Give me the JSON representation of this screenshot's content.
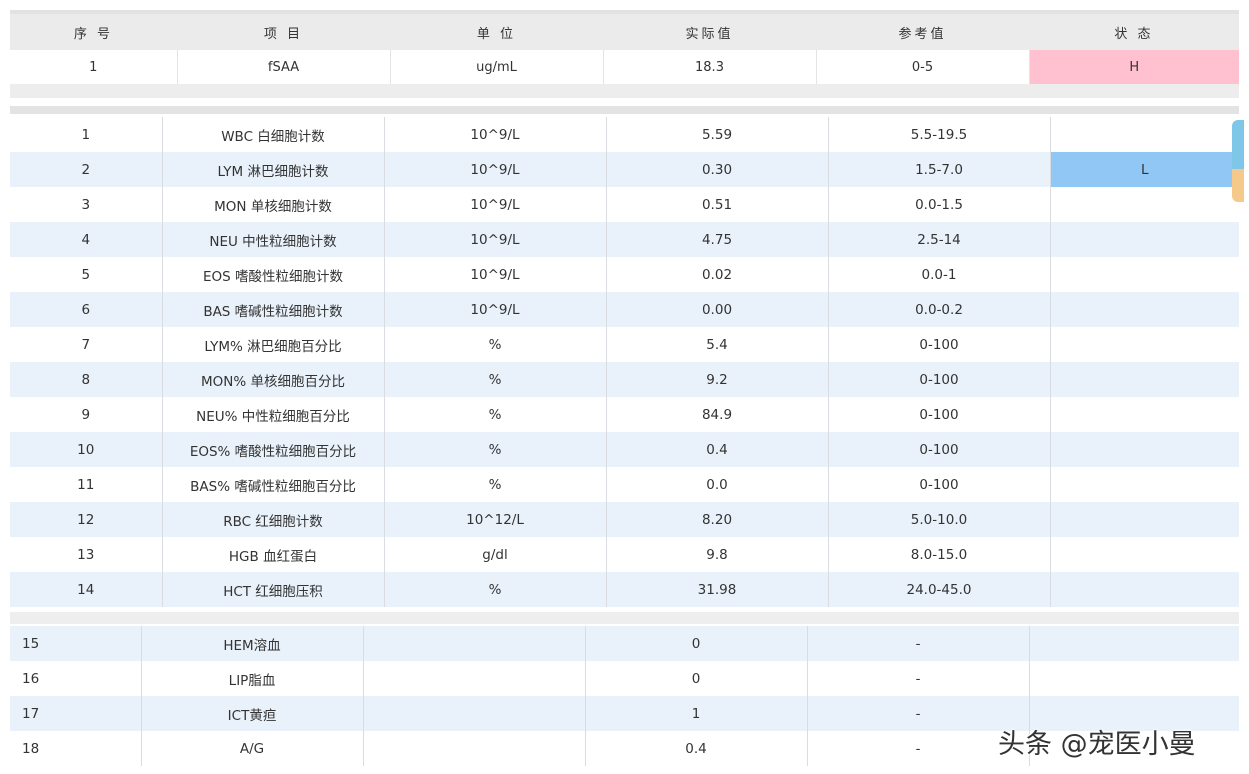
{
  "header": {
    "columns": [
      "序 号",
      "项 目",
      "单 位",
      "实际值",
      "参考值",
      "状 态"
    ]
  },
  "summary_row": {
    "index": "1",
    "item": "fSAA",
    "unit": "ug/mL",
    "actual": "18.3",
    "reference": "0-5",
    "status": "H"
  },
  "rows": [
    {
      "index": "1",
      "item": "WBC 白细胞计数",
      "unit": "10^9/L",
      "actual": "5.59",
      "reference": "5.5-19.5",
      "status": ""
    },
    {
      "index": "2",
      "item": "LYM 淋巴细胞计数",
      "unit": "10^9/L",
      "actual": "0.30",
      "reference": "1.5-7.0",
      "status": "L"
    },
    {
      "index": "3",
      "item": "MON 单核细胞计数",
      "unit": "10^9/L",
      "actual": "0.51",
      "reference": "0.0-1.5",
      "status": ""
    },
    {
      "index": "4",
      "item": "NEU 中性粒细胞计数",
      "unit": "10^9/L",
      "actual": "4.75",
      "reference": "2.5-14",
      "status": ""
    },
    {
      "index": "5",
      "item": "EOS 嗜酸性粒细胞计数",
      "unit": "10^9/L",
      "actual": "0.02",
      "reference": "0.0-1",
      "status": ""
    },
    {
      "index": "6",
      "item": "BAS 嗜碱性粒细胞计数",
      "unit": "10^9/L",
      "actual": "0.00",
      "reference": "0.0-0.2",
      "status": ""
    },
    {
      "index": "7",
      "item": "LYM% 淋巴细胞百分比",
      "unit": "%",
      "actual": "5.4",
      "reference": "0-100",
      "status": ""
    },
    {
      "index": "8",
      "item": "MON% 单核细胞百分比",
      "unit": "%",
      "actual": "9.2",
      "reference": "0-100",
      "status": ""
    },
    {
      "index": "9",
      "item": "NEU% 中性粒细胞百分比",
      "unit": "%",
      "actual": "84.9",
      "reference": "0-100",
      "status": ""
    },
    {
      "index": "10",
      "item": "EOS% 嗜酸性粒细胞百分比",
      "unit": "%",
      "actual": "0.4",
      "reference": "0-100",
      "status": ""
    },
    {
      "index": "11",
      "item": "BAS% 嗜碱性粒细胞百分比",
      "unit": "%",
      "actual": "0.0",
      "reference": "0-100",
      "status": ""
    },
    {
      "index": "12",
      "item": "RBC 红细胞计数",
      "unit": "10^12/L",
      "actual": "8.20",
      "reference": "5.0-10.0",
      "status": ""
    },
    {
      "index": "13",
      "item": "HGB 血红蛋白",
      "unit": "g/dl",
      "actual": "9.8",
      "reference": "8.0-15.0",
      "status": ""
    },
    {
      "index": "14",
      "item": "HCT 红细胞压积",
      "unit": "%",
      "actual": "31.98",
      "reference": "24.0-45.0",
      "status": ""
    }
  ],
  "serum_rows": [
    {
      "index": "15",
      "item": "HEM溶血",
      "unit": "",
      "actual": "0",
      "reference": "-",
      "status": ""
    },
    {
      "index": "16",
      "item": "LIP脂血",
      "unit": "",
      "actual": "0",
      "reference": "-",
      "status": ""
    },
    {
      "index": "17",
      "item": "ICT黄疸",
      "unit": "",
      "actual": "1",
      "reference": "-",
      "status": ""
    },
    {
      "index": "18",
      "item": "A/G",
      "unit": "",
      "actual": "0.4",
      "reference": "-",
      "status": ""
    }
  ],
  "watermark": "头条 @宠医小曼",
  "colors": {
    "status_high": "#ffc0cf",
    "status_low": "#91c7f5",
    "row_stripe": "#e9f2fb"
  }
}
